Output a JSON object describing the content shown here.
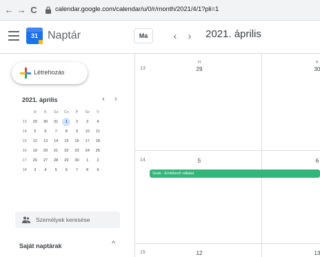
{
  "browser": {
    "url": "calendar.google.com/calendar/u/0/r/month/2021/4/1?pli=1",
    "back_icon": "←",
    "forward_icon": "→",
    "reload_icon": "C"
  },
  "header": {
    "app_name": "Naptár",
    "logo_day": "31",
    "today_label": "Ma",
    "prev_icon": "‹",
    "next_icon": "›",
    "month_title": "2021. április"
  },
  "sidebar": {
    "create_label": "Létrehozás",
    "mini": {
      "title": "2021. április",
      "prev_icon": "‹",
      "next_icon": "›",
      "headers": [
        "",
        "H",
        "K",
        "Sz",
        "Cs",
        "P",
        "Sz",
        "V"
      ],
      "rows": [
        [
          "13",
          "29",
          "30",
          "31",
          "1",
          "2",
          "3",
          "4"
        ],
        [
          "14",
          "5",
          "6",
          "7",
          "8",
          "9",
          "10",
          "11"
        ],
        [
          "15",
          "12",
          "13",
          "14",
          "15",
          "16",
          "17",
          "18"
        ],
        [
          "16",
          "19",
          "20",
          "21",
          "22",
          "23",
          "24",
          "25"
        ],
        [
          "17",
          "26",
          "27",
          "28",
          "29",
          "30",
          "1",
          "2"
        ],
        [
          "18",
          "3",
          "4",
          "5",
          "6",
          "7",
          "8",
          "9"
        ]
      ],
      "today": "1"
    },
    "people_search": "Személyek keresése",
    "my_calendars": "Saját naptárak",
    "my_calendars_chev": "^"
  },
  "grid": {
    "day_headers": [
      "H",
      "K"
    ],
    "weeks": [
      {
        "week": "13",
        "days": [
          "29",
          "30"
        ]
      },
      {
        "week": "14",
        "days": [
          "5",
          "6"
        ]
      },
      {
        "week": "15",
        "days": [
          "12",
          "13"
        ]
      }
    ],
    "event": "Szab · Emlékező vállalat"
  },
  "colors": {
    "accent": "#1a73e8",
    "event": "#33b679",
    "today_bg": "#d2e3fc"
  }
}
